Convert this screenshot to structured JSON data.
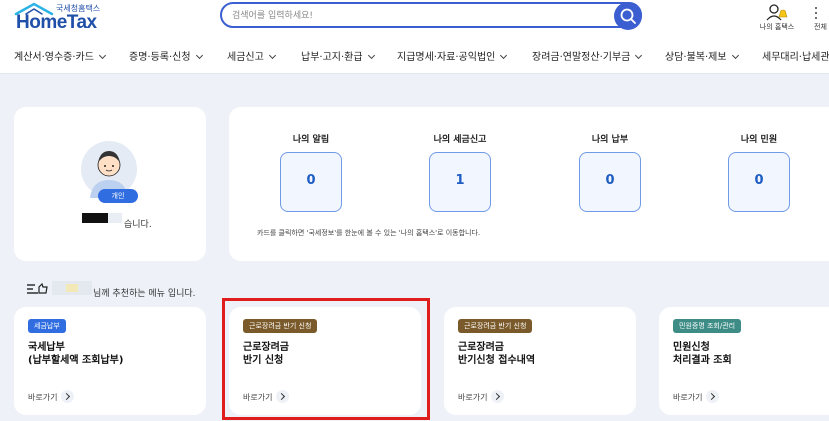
{
  "header": {
    "logo_small": "국세청홈택스",
    "logo_main": "HomeTax",
    "search_placeholder": "검색어를 입력하세요!",
    "myhome_label": "나의 홈택스",
    "more_label": "전체"
  },
  "nav": {
    "items": [
      {
        "label": "계산서·영수증·카드"
      },
      {
        "label": "증명·등록·신청"
      },
      {
        "label": "세금신고"
      },
      {
        "label": "납부·고지·환급"
      },
      {
        "label": "지급명세·자료·공익법인"
      },
      {
        "label": "장려금·연말정산·기부금"
      },
      {
        "label": "상담·불복·제보"
      },
      {
        "label": "세무대리·납세관리"
      }
    ]
  },
  "profile": {
    "badge": "개인",
    "greeting_suffix": "습니다."
  },
  "summary": {
    "stats": [
      {
        "title": "나의 알림",
        "value": "0"
      },
      {
        "title": "나의 세금신고",
        "value": "1"
      },
      {
        "title": "나의 납부",
        "value": "0"
      },
      {
        "title": "나의 민원",
        "value": "0"
      }
    ],
    "note": "카드를 클릭하면 '국세정보'를 한눈에 볼 수 있는 '나의 홈택스'로 이동합니다."
  },
  "recommend": {
    "text": "님께 추천하는 메뉴 입니다."
  },
  "menu_cards": [
    {
      "tag": "세금납부",
      "title_line1": "국세납부",
      "title_line2": "(납부할세액 조회납부)",
      "link": "바로가기"
    },
    {
      "tag": "근로장려금 반기 신청",
      "title_line1": "근로장려금",
      "title_line2": "반기 신청",
      "link": "바로가기"
    },
    {
      "tag": "근로장려금 반기 신청",
      "title_line1": "근로장려금",
      "title_line2": "반기신청 접수내역",
      "link": "바로가기"
    },
    {
      "tag": "민원증명 조회/관리",
      "title_line1": "민원신청",
      "title_line2": "처리결과 조회",
      "link": "바로가기"
    }
  ],
  "colors": {
    "accent": "#3b5fd1",
    "highlight": "#e01c1c",
    "tag_blue": "#2f6de0",
    "tag_brown": "#7a5a2a",
    "tag_teal": "#3d8c86"
  }
}
